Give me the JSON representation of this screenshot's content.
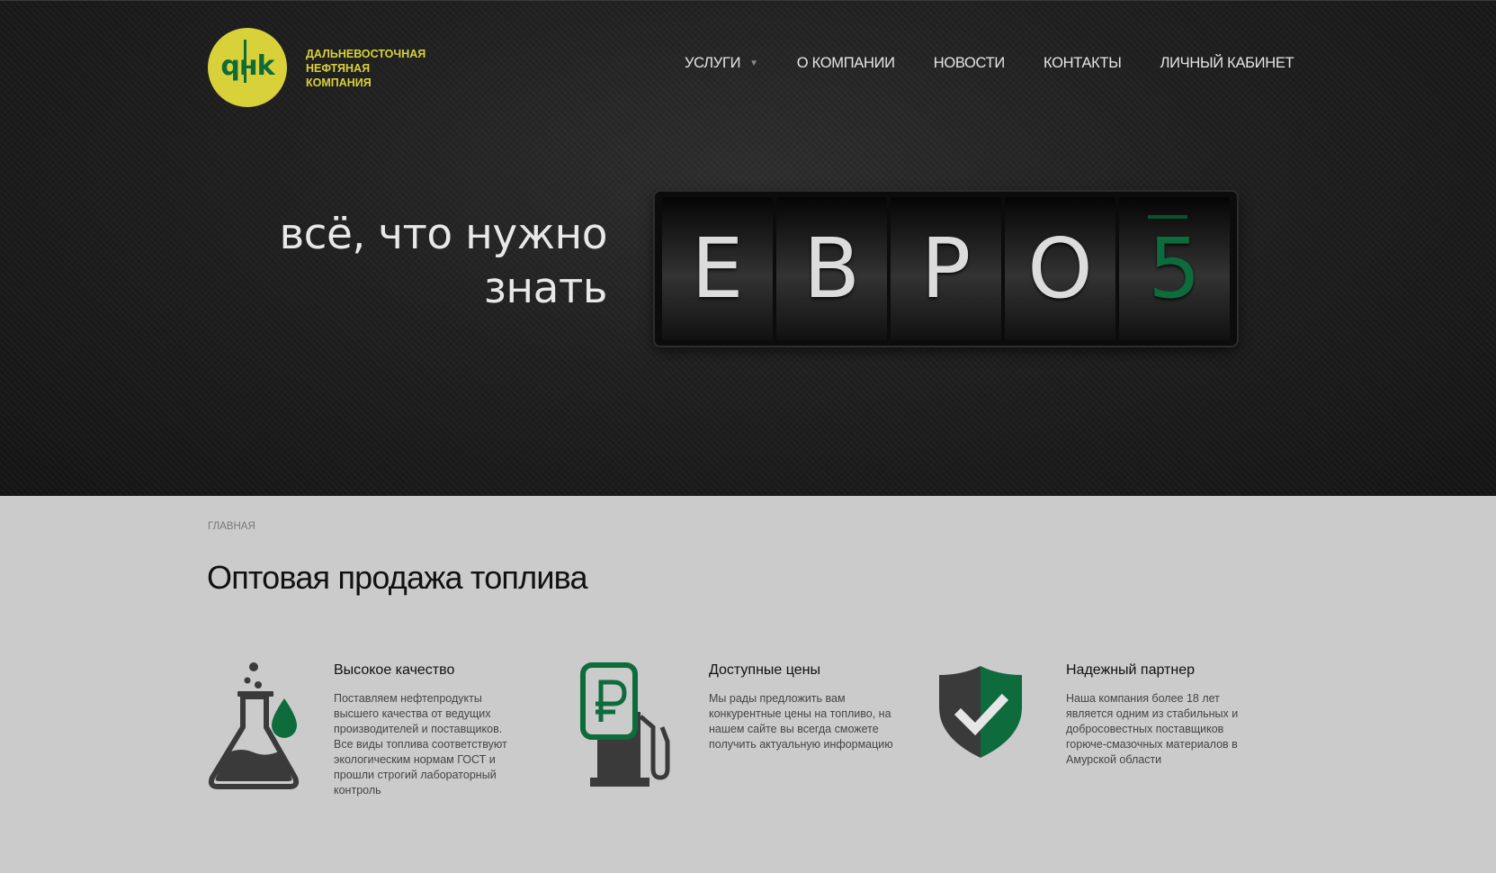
{
  "header": {
    "logo_mark": "qнk",
    "logo_lines": [
      "ДАЛЬНЕВОСТОЧНАЯ",
      "НЕФТЯНАЯ",
      "КОМПАНИЯ"
    ],
    "nav": [
      {
        "label": "УСЛУГИ",
        "has_dropdown": true
      },
      {
        "label": "О КОМПАНИИ"
      },
      {
        "label": "НОВОСТИ"
      },
      {
        "label": "КОНТАКТЫ"
      },
      {
        "label": "ЛИЧНЫЙ КАБИНЕТ"
      }
    ]
  },
  "hero": {
    "tagline_lines": [
      "всё, что нужно",
      "знать"
    ],
    "odometer": [
      "Е",
      "В",
      "Р",
      "О",
      "5"
    ]
  },
  "main": {
    "breadcrumb": "ГЛАВНАЯ",
    "title": "Оптовая продажа топлива",
    "features": [
      {
        "title": "Высокое качество",
        "text": "Поставляем нефтепродукты высшего качества от ведущих производителей и поставщиков. Все виды топлива соответствуют экологическим нормам ГОСТ и прошли строгий лабораторный контроль",
        "icon": "flask-icon"
      },
      {
        "title": "Доступные цены",
        "text": "Мы рады предложить вам конкурентные цены на топливо, на нашем сайте вы всегда сможете получить актуальную информацию",
        "icon": "fuel-pump-ruble-icon"
      },
      {
        "title": "Надежный партнер",
        "text": "Наша компания более 18 лет является одним из стабильных и добросовестных поставщиков горюче-смазочных материалов в Амурской области",
        "icon": "shield-check-icon"
      }
    ]
  },
  "colors": {
    "brand_yellow": "#d9d13a",
    "brand_green": "#0f6b37",
    "hero_bg": "#1e1e1e",
    "content_bg": "#cbcbcb"
  }
}
